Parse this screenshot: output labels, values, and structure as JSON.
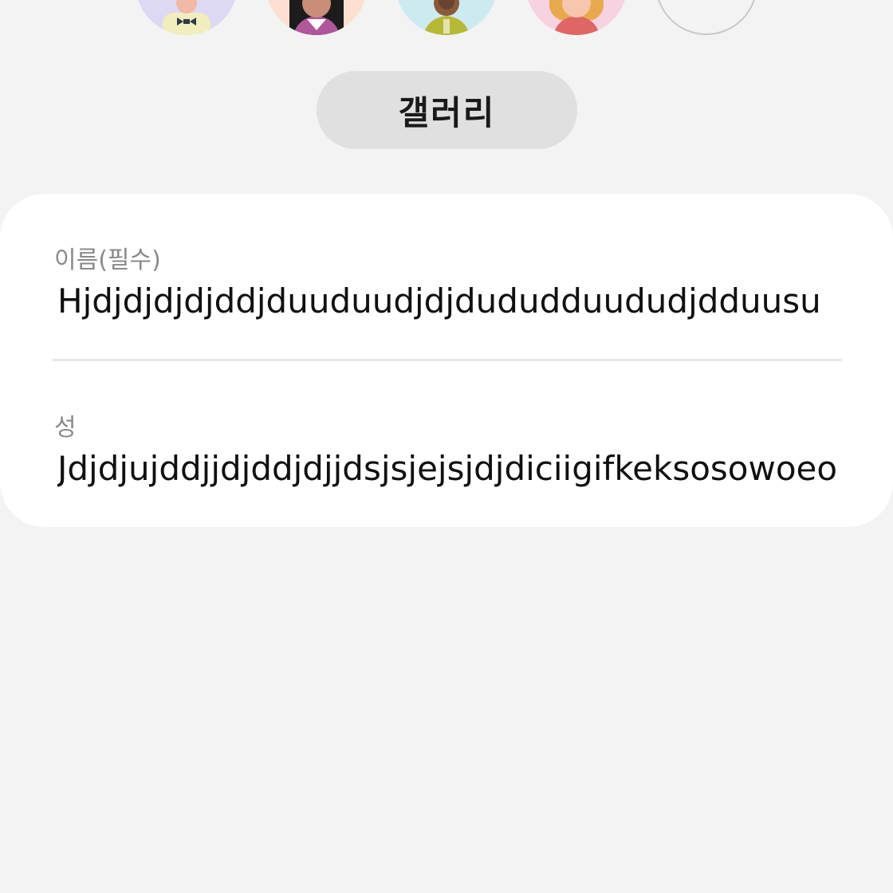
{
  "avatars": [
    {
      "icon": "avatar-boy-bowtie-icon",
      "bg": "#ddd9f3"
    },
    {
      "icon": "avatar-girl-dark-hair-icon",
      "bg": "#fde0cf"
    },
    {
      "icon": "avatar-boy-dark-skin-icon",
      "bg": "#cdeaf1"
    },
    {
      "icon": "avatar-girl-blonde-icon",
      "bg": "#f7d3e2"
    },
    {
      "icon": "avatar-empty-icon",
      "bg": "transparent"
    }
  ],
  "gallery_button": {
    "label": "갤러리",
    "bg": "#e0e0e0"
  },
  "form": {
    "first_name": {
      "label": "이름(필수)",
      "value": "Hjdjdjdjdjddjduuduudjdjdududduududjdduusu"
    },
    "last_name": {
      "label": "성",
      "value": "Jdjdjujddjjdjddjdjjdsjsjejsjdjdiciigifkeksosowoeo"
    }
  }
}
